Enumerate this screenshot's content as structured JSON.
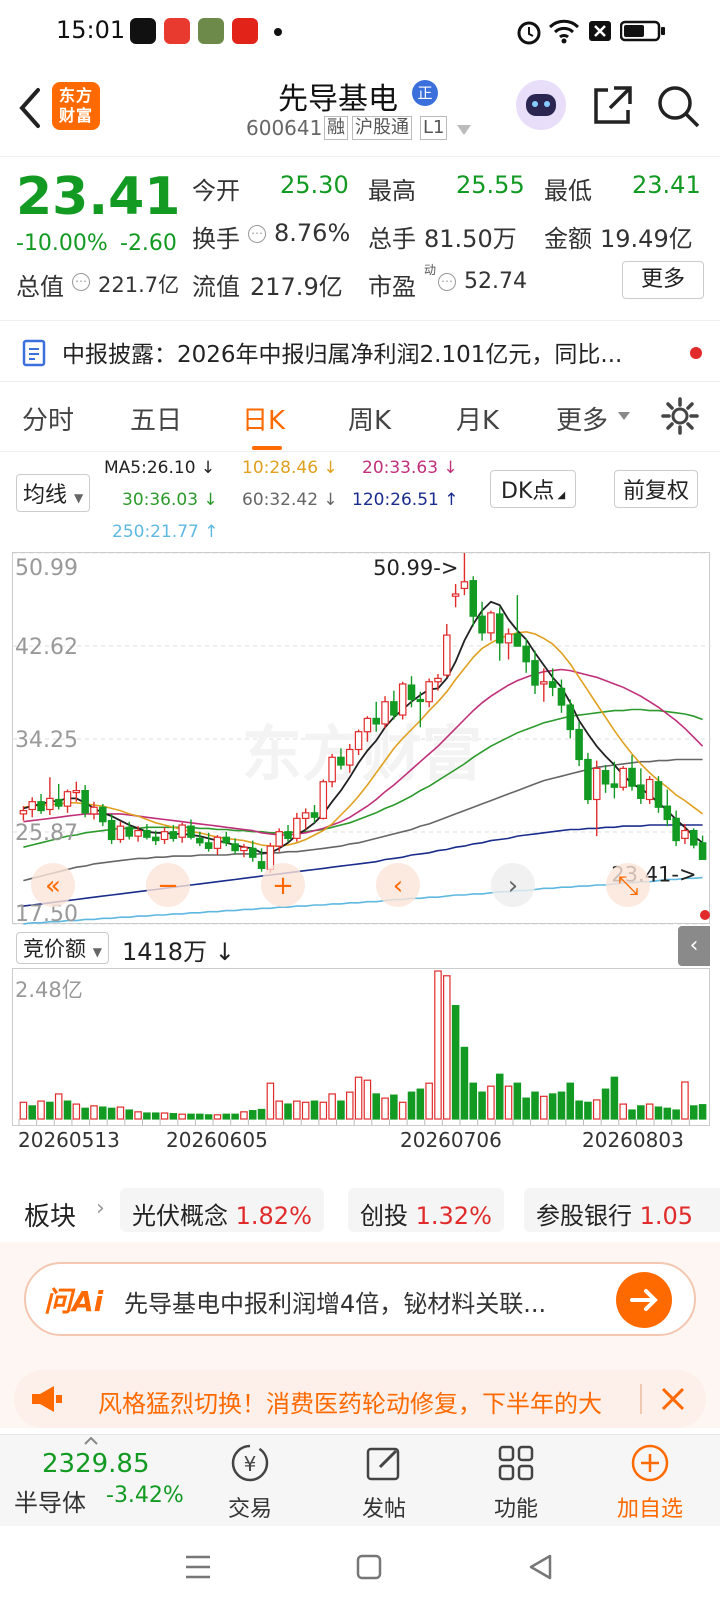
{
  "status": {
    "time": "15:01"
  },
  "header": {
    "logo": "东方财富",
    "stock_name": "先导基电",
    "badge": "正",
    "code": "600641",
    "tags": [
      "融",
      "沪股通",
      "L1"
    ]
  },
  "quote": {
    "price": "23.41",
    "pct": "-10.00%",
    "chg": "-2.60",
    "open_label": "今开",
    "open": "25.30",
    "high_label": "最高",
    "high": "25.55",
    "low_label": "最低",
    "low": "23.41",
    "turnover_label": "换手",
    "turnover": "8.76%",
    "vol_label": "总手",
    "vol": "81.50万",
    "amount_label": "金额",
    "amount": "19.49亿",
    "mktcap_label": "总值",
    "mktcap": "221.7亿",
    "float_label": "流值",
    "float": "217.9亿",
    "pe_label": "市盈",
    "pe_sup": "动",
    "pe": "52.74",
    "more": "更多"
  },
  "announce": {
    "text": "中报披露：2026年中报归属净利润2.101亿元，同比..."
  },
  "tabs": [
    "分时",
    "五日",
    "日K",
    "周K",
    "月K",
    "更多"
  ],
  "active_tab": "日K",
  "ma": {
    "selector": "均线",
    "ma5": "MA5:26.10 ↓",
    "ma10": "10:28.46 ↓",
    "ma20": "20:33.63 ↓",
    "ma30": "30:36.03 ↓",
    "ma60": "60:32.42 ↓",
    "ma120": "120:26.51 ↑",
    "ma250": "250:21.77 ↑",
    "dk": "DK点",
    "adjust": "前复权"
  },
  "colors": {
    "up": "#e12b2b",
    "down": "#139a23",
    "accent": "#ff6a00",
    "ma5": "#222222",
    "ma10": "#e0a020",
    "ma20": "#c0307a",
    "ma30": "#2c9a2c",
    "ma60": "#666666",
    "ma120": "#1a2c8c",
    "ma250": "#5fb8e0"
  },
  "chart_data": {
    "type": "candlestick",
    "y_ticks": [
      "50.99",
      "42.62",
      "34.25",
      "25.87",
      "17.50"
    ],
    "ylim": [
      17.5,
      50.99
    ],
    "max_label": "50.99->",
    "last_label": "23.41->",
    "watermark": "东方财富",
    "candles": [
      [
        27.5,
        28.2,
        26.9,
        27.8
      ],
      [
        27.9,
        29.0,
        27.2,
        28.6
      ],
      [
        28.6,
        29.3,
        27.5,
        27.8
      ],
      [
        27.9,
        30.8,
        27.4,
        28.9
      ],
      [
        28.8,
        30.2,
        27.9,
        28.2
      ],
      [
        28.2,
        29.7,
        27.6,
        29.5
      ],
      [
        29.5,
        30.4,
        28.6,
        29.6
      ],
      [
        29.6,
        30.1,
        27.2,
        27.6
      ],
      [
        27.5,
        28.6,
        27.0,
        28.1
      ],
      [
        28.1,
        28.4,
        26.4,
        26.8
      ],
      [
        26.9,
        27.5,
        24.8,
        25.2
      ],
      [
        25.2,
        26.8,
        24.9,
        26.4
      ],
      [
        26.3,
        26.8,
        25.2,
        25.5
      ],
      [
        25.5,
        26.4,
        25.0,
        26.0
      ],
      [
        26.0,
        26.6,
        25.2,
        25.4
      ],
      [
        25.4,
        26.0,
        24.7,
        25.1
      ],
      [
        25.2,
        26.3,
        24.8,
        25.9
      ],
      [
        25.9,
        26.5,
        25.0,
        25.3
      ],
      [
        25.4,
        26.7,
        24.9,
        26.5
      ],
      [
        26.4,
        27.0,
        25.2,
        25.4
      ],
      [
        25.3,
        25.9,
        24.6,
        24.9
      ],
      [
        24.9,
        25.8,
        24.1,
        24.4
      ],
      [
        24.4,
        25.6,
        23.8,
        25.4
      ],
      [
        25.4,
        25.9,
        24.6,
        24.9
      ],
      [
        24.8,
        25.3,
        23.9,
        24.2
      ],
      [
        24.2,
        24.8,
        23.6,
        24.5
      ],
      [
        24.4,
        25.1,
        23.2,
        23.6
      ],
      [
        23.2,
        24.4,
        22.3,
        22.6
      ],
      [
        22.5,
        24.9,
        22.2,
        24.6
      ],
      [
        24.6,
        26.2,
        24.1,
        25.9
      ],
      [
        25.9,
        26.5,
        25.0,
        25.3
      ],
      [
        25.3,
        27.6,
        25.0,
        27.1
      ],
      [
        27.1,
        28.0,
        26.1,
        27.6
      ],
      [
        27.6,
        28.3,
        26.7,
        27.2
      ],
      [
        27.1,
        30.6,
        27.0,
        30.4
      ],
      [
        30.4,
        32.9,
        29.9,
        32.6
      ],
      [
        32.6,
        33.4,
        31.5,
        31.9
      ],
      [
        31.9,
        33.8,
        31.2,
        33.3
      ],
      [
        33.3,
        35.1,
        32.8,
        34.9
      ],
      [
        34.9,
        36.3,
        34.0,
        36.1
      ],
      [
        36.1,
        37.6,
        34.9,
        35.6
      ],
      [
        35.6,
        38.1,
        35.2,
        37.6
      ],
      [
        37.6,
        38.6,
        36.0,
        36.4
      ],
      [
        36.4,
        39.4,
        36.0,
        39.2
      ],
      [
        39.1,
        39.9,
        37.1,
        37.8
      ],
      [
        37.8,
        38.5,
        35.3,
        37.7
      ],
      [
        37.6,
        39.7,
        37.1,
        39.4
      ],
      [
        39.4,
        40.1,
        38.6,
        39.7
      ],
      [
        40.0,
        44.6,
        39.8,
        43.6
      ],
      [
        47.1,
        48.2,
        46.1,
        47.3
      ],
      [
        47.8,
        50.99,
        47.2,
        48.4
      ],
      [
        48.5,
        48.9,
        44.4,
        45.3
      ],
      [
        45.3,
        46.6,
        43.1,
        43.8
      ],
      [
        43.8,
        45.8,
        43.1,
        45.6
      ],
      [
        45.5,
        46.1,
        41.3,
        42.9
      ],
      [
        42.9,
        44.2,
        41.4,
        43.7
      ],
      [
        43.7,
        47.2,
        42.8,
        42.6
      ],
      [
        42.6,
        43.3,
        40.2,
        41.2
      ],
      [
        41.3,
        42.2,
        38.3,
        39.1
      ],
      [
        39.2,
        40.6,
        37.6,
        39.4
      ],
      [
        39.4,
        40.6,
        38.1,
        38.9
      ],
      [
        38.8,
        39.6,
        36.6,
        37.3
      ],
      [
        37.3,
        37.8,
        34.3,
        35.1
      ],
      [
        35.1,
        35.8,
        31.8,
        32.4
      ],
      [
        32.4,
        33.0,
        28.4,
        28.8
      ],
      [
        28.8,
        32.3,
        25.5,
        31.6
      ],
      [
        31.4,
        31.9,
        29.4,
        30.2
      ],
      [
        30.2,
        32.2,
        28.9,
        29.9
      ],
      [
        29.9,
        31.8,
        29.6,
        31.6
      ],
      [
        31.6,
        32.8,
        29.6,
        30.0
      ],
      [
        30.1,
        31.6,
        28.4,
        28.9
      ],
      [
        28.8,
        30.9,
        28.4,
        30.6
      ],
      [
        30.4,
        30.9,
        27.6,
        28.1
      ],
      [
        28.2,
        29.7,
        26.4,
        27.0
      ],
      [
        27.1,
        27.8,
        24.6,
        25.1
      ],
      [
        25.3,
        26.6,
        24.8,
        26.0
      ],
      [
        26.0,
        26.2,
        24.4,
        24.7
      ],
      [
        24.9,
        25.55,
        23.41,
        23.41
      ]
    ],
    "ma5": [
      28.0,
      28.2,
      28.4,
      28.6,
      28.7,
      28.9,
      28.9,
      28.5,
      28.0,
      27.6,
      27.3,
      26.9,
      26.5,
      26.2,
      25.9,
      25.8,
      25.8,
      25.7,
      25.7,
      25.6,
      25.5,
      25.3,
      25.1,
      24.9,
      24.7,
      24.5,
      24.4,
      24.0,
      24.0,
      24.4,
      24.9,
      25.6,
      26.1,
      26.7,
      27.5,
      28.6,
      29.6,
      30.8,
      32.1,
      33.2,
      34.1,
      35.3,
      36.2,
      36.9,
      37.6,
      38.2,
      38.7,
      38.8,
      39.7,
      41.2,
      43.1,
      44.6,
      45.8,
      46.6,
      46.3,
      45.0,
      44.0,
      43.2,
      42.0,
      40.9,
      39.8,
      38.9,
      37.5,
      35.9,
      34.7,
      33.6,
      32.7,
      31.9,
      31.0,
      30.2,
      29.8,
      29.2,
      28.5,
      27.8,
      27.0,
      26.3,
      25.5,
      24.9
    ],
    "ma10": [
      28.1,
      28.2,
      28.3,
      28.3,
      28.4,
      28.5,
      28.5,
      28.4,
      28.3,
      28.2,
      28.0,
      27.8,
      27.5,
      27.3,
      27.0,
      26.7,
      26.5,
      26.3,
      26.1,
      25.9,
      25.8,
      25.6,
      25.4,
      25.3,
      25.2,
      25.1,
      24.9,
      24.7,
      24.6,
      24.6,
      24.7,
      24.9,
      25.2,
      25.6,
      26.0,
      26.6,
      27.4,
      28.2,
      29.1,
      30.1,
      31.2,
      32.3,
      33.4,
      34.3,
      35.1,
      35.9,
      36.8,
      37.6,
      38.5,
      39.6,
      40.6,
      41.6,
      42.4,
      42.9,
      43.3,
      43.6,
      43.8,
      43.9,
      43.7,
      43.3,
      42.8,
      42.0,
      41.0,
      39.8,
      38.6,
      37.4,
      36.2,
      35.0,
      33.9,
      32.9,
      32.0,
      31.2,
      30.5,
      29.9,
      29.2,
      28.7,
      28.1,
      27.5
    ],
    "ma20": [
      26.8,
      26.9,
      27.0,
      27.1,
      27.2,
      27.3,
      27.4,
      27.5,
      27.5,
      27.5,
      27.5,
      27.5,
      27.4,
      27.3,
      27.2,
      27.1,
      27.0,
      26.9,
      26.8,
      26.7,
      26.6,
      26.5,
      26.4,
      26.3,
      26.2,
      26.1,
      26.0,
      25.8,
      25.7,
      25.6,
      25.6,
      25.7,
      25.8,
      26.0,
      26.2,
      26.5,
      26.8,
      27.2,
      27.7,
      28.2,
      28.8,
      29.5,
      30.1,
      30.8,
      31.5,
      32.2,
      32.9,
      33.6,
      34.4,
      35.2,
      36.0,
      36.8,
      37.5,
      38.1,
      38.6,
      39.1,
      39.5,
      39.8,
      40.1,
      40.3,
      40.4,
      40.5,
      40.4,
      40.2,
      40.0,
      39.8,
      39.5,
      39.2,
      38.9,
      38.5,
      38.1,
      37.6,
      37.1,
      36.5,
      35.9,
      35.2,
      34.4,
      33.6
    ],
    "ma30": [
      24.5,
      24.7,
      24.9,
      25.1,
      25.3,
      25.5,
      25.6,
      25.8,
      25.9,
      26.0,
      26.1,
      26.2,
      26.2,
      26.2,
      26.3,
      26.3,
      26.3,
      26.3,
      26.3,
      26.3,
      26.2,
      26.2,
      26.1,
      26.1,
      26.0,
      26.0,
      25.9,
      25.9,
      25.8,
      25.8,
      25.8,
      25.9,
      25.9,
      26.0,
      26.1,
      26.3,
      26.5,
      26.7,
      27.0,
      27.3,
      27.6,
      28.0,
      28.3,
      28.7,
      29.1,
      29.6,
      30.0,
      30.5,
      31.0,
      31.5,
      32.0,
      32.6,
      33.1,
      33.6,
      34.0,
      34.4,
      34.8,
      35.1,
      35.4,
      35.7,
      35.9,
      36.1,
      36.3,
      36.4,
      36.5,
      36.6,
      36.7,
      36.8,
      36.8,
      36.9,
      36.9,
      36.8,
      36.8,
      36.7,
      36.6,
      36.5,
      36.3,
      36.0
    ],
    "ma60": [
      21.5,
      21.7,
      21.9,
      22.1,
      22.3,
      22.5,
      22.7,
      22.8,
      23.0,
      23.1,
      23.2,
      23.3,
      23.4,
      23.5,
      23.5,
      23.6,
      23.6,
      23.7,
      23.7,
      23.7,
      23.8,
      23.8,
      23.8,
      23.8,
      23.9,
      23.9,
      23.9,
      23.9,
      24.0,
      24.0,
      24.1,
      24.1,
      24.2,
      24.3,
      24.4,
      24.5,
      24.6,
      24.8,
      24.9,
      25.1,
      25.3,
      25.5,
      25.7,
      25.9,
      26.1,
      26.4,
      26.6,
      26.9,
      27.2,
      27.5,
      27.8,
      28.1,
      28.4,
      28.7,
      29.0,
      29.3,
      29.6,
      29.9,
      30.2,
      30.5,
      30.7,
      30.9,
      31.1,
      31.3,
      31.5,
      31.7,
      31.8,
      31.9,
      32.0,
      32.1,
      32.2,
      32.2,
      32.3,
      32.3,
      32.4,
      32.4,
      32.4,
      32.4
    ],
    "ma120": [
      19.2,
      19.3,
      19.4,
      19.5,
      19.6,
      19.7,
      19.8,
      19.9,
      20.0,
      20.1,
      20.2,
      20.3,
      20.4,
      20.5,
      20.6,
      20.7,
      20.8,
      20.9,
      21.0,
      21.1,
      21.2,
      21.3,
      21.4,
      21.5,
      21.6,
      21.7,
      21.8,
      21.9,
      22.0,
      22.1,
      22.2,
      22.3,
      22.4,
      22.5,
      22.6,
      22.7,
      22.8,
      22.9,
      23.0,
      23.1,
      23.2,
      23.4,
      23.5,
      23.6,
      23.8,
      23.9,
      24.0,
      24.2,
      24.3,
      24.5,
      24.6,
      24.8,
      24.9,
      25.1,
      25.2,
      25.3,
      25.5,
      25.6,
      25.7,
      25.8,
      25.9,
      26.0,
      26.1,
      26.1,
      26.2,
      26.2,
      26.3,
      26.3,
      26.4,
      26.4,
      26.4,
      26.5,
      26.5,
      26.5,
      26.5,
      26.5,
      26.5,
      26.5
    ],
    "ma250": [
      17.6,
      17.7,
      17.7,
      17.8,
      17.8,
      17.9,
      17.9,
      18.0,
      18.0,
      18.1,
      18.1,
      18.2,
      18.2,
      18.3,
      18.3,
      18.4,
      18.4,
      18.5,
      18.5,
      18.6,
      18.6,
      18.7,
      18.7,
      18.8,
      18.8,
      18.9,
      18.9,
      19.0,
      19.0,
      19.1,
      19.1,
      19.2,
      19.2,
      19.3,
      19.3,
      19.4,
      19.4,
      19.5,
      19.5,
      19.6,
      19.6,
      19.7,
      19.8,
      19.8,
      19.9,
      19.9,
      20.0,
      20.0,
      20.1,
      20.2,
      20.2,
      20.3,
      20.3,
      20.4,
      20.5,
      20.5,
      20.6,
      20.6,
      20.7,
      20.8,
      20.8,
      20.9,
      20.9,
      21.0,
      21.0,
      21.1,
      21.1,
      21.2,
      21.3,
      21.3,
      21.4,
      21.4,
      21.5,
      21.6,
      21.6,
      21.7,
      21.7,
      21.77
    ],
    "nav_icons": [
      "double-left-icon",
      "minus-icon",
      "plus-icon",
      "prev-icon",
      "next-icon",
      "fullscreen-icon"
    ],
    "volume": {
      "label": "竞价额",
      "value": "1418万 ↓",
      "max_label": "2.48亿",
      "max": 2.48,
      "x_labels": [
        "20260513",
        "20260605",
        "20260706",
        "20260803"
      ],
      "bars": [
        0.28,
        0.22,
        0.3,
        0.28,
        0.42,
        0.3,
        0.25,
        0.18,
        0.22,
        0.2,
        0.18,
        0.2,
        0.15,
        0.12,
        0.1,
        0.1,
        0.1,
        0.09,
        0.08,
        0.08,
        0.08,
        0.07,
        0.07,
        0.08,
        0.08,
        0.12,
        0.14,
        0.16,
        0.6,
        0.3,
        0.25,
        0.3,
        0.28,
        0.3,
        0.28,
        0.42,
        0.3,
        0.45,
        0.7,
        0.65,
        0.42,
        0.35,
        0.4,
        0.28,
        0.45,
        0.5,
        0.6,
        2.48,
        2.4,
        1.9,
        1.2,
        0.6,
        0.45,
        0.55,
        0.75,
        0.55,
        0.6,
        0.35,
        0.45,
        0.38,
        0.42,
        0.45,
        0.6,
        0.3,
        0.28,
        0.32,
        0.5,
        0.7,
        0.25,
        0.15,
        0.22,
        0.25,
        0.2,
        0.18,
        0.15,
        0.62,
        0.22,
        0.24
      ],
      "up": [
        true,
        false,
        true,
        false,
        true,
        false,
        true,
        false,
        true,
        false,
        false,
        true,
        false,
        true,
        false,
        false,
        true,
        false,
        true,
        false,
        false,
        false,
        true,
        false,
        false,
        true,
        false,
        false,
        true,
        true,
        false,
        true,
        true,
        false,
        true,
        true,
        false,
        true,
        true,
        true,
        false,
        true,
        false,
        true,
        false,
        false,
        true,
        true,
        true,
        false,
        false,
        false,
        false,
        true,
        false,
        true,
        false,
        false,
        false,
        true,
        false,
        false,
        false,
        false,
        false,
        true,
        false,
        false,
        true,
        false,
        false,
        true,
        false,
        false,
        false,
        true,
        false,
        false
      ]
    }
  },
  "sectors": {
    "label": "板块",
    "items": [
      {
        "name": "光伏概念",
        "pct": "1.82%"
      },
      {
        "name": "创投",
        "pct": "1.32%"
      },
      {
        "name": "参股银行",
        "pct": "1.05"
      }
    ]
  },
  "ai": {
    "brand": "问Ai",
    "text": "先导基电中报利润增4倍，铋材料关联..."
  },
  "promo": {
    "text": "风格猛烈切换！消费医药轮动修复，下半年的大"
  },
  "bottom": {
    "index_value": "2329.85",
    "index_name": "半导体",
    "index_pct": "-3.42%",
    "nav": [
      "交易",
      "发帖",
      "功能",
      "加自选"
    ]
  }
}
